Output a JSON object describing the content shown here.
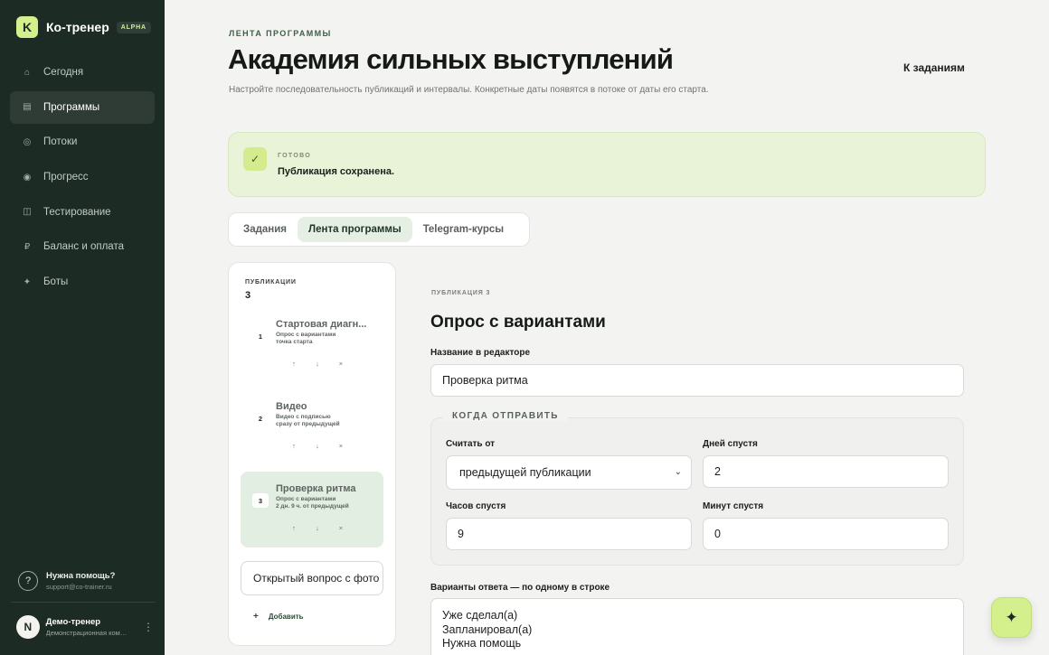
{
  "brand": {
    "logo_letter": "K",
    "name": "Ко-тренер",
    "badge": "ALPHA"
  },
  "nav": [
    {
      "label": "Сегодня",
      "icon": "home-icon",
      "glyph": "⌂"
    },
    {
      "label": "Программы",
      "icon": "list-icon",
      "glyph": "▤"
    },
    {
      "label": "Потоки",
      "icon": "flow-icon",
      "glyph": "◎"
    },
    {
      "label": "Прогресс",
      "icon": "progress-icon",
      "glyph": "◉"
    },
    {
      "label": "Тестирование",
      "icon": "test-icon",
      "glyph": "◫"
    },
    {
      "label": "Баланс и оплата",
      "icon": "ruble-icon",
      "glyph": "₽"
    },
    {
      "label": "Боты",
      "icon": "sparkle-icon",
      "glyph": "✦"
    }
  ],
  "nav_active": "Программы",
  "help": {
    "icon": "?",
    "title": "Нужна помощь?",
    "email": "support@co-trainer.ru"
  },
  "user": {
    "initial": "N",
    "name": "Демо-тренер",
    "org": "Демонстрационная ком…",
    "menu": "⋮"
  },
  "header": {
    "eyebrow": "ЛЕНТА ПРОГРАММЫ",
    "title": "Академия сильных выступлений",
    "description": "Настройте последовательность публикаций и интервалы. Конкретные даты появятся в потоке от даты его старта.",
    "back_link": "К заданиям"
  },
  "alert": {
    "icon": "✓",
    "label": "ГОТОВО",
    "message": "Публикация сохранена."
  },
  "tabs": [
    {
      "label": "Задания"
    },
    {
      "label": "Лента программы"
    },
    {
      "label": "Telegram-курсы"
    }
  ],
  "publications": {
    "label": "ПУБЛИКАЦИИ",
    "count": "3",
    "items": [
      {
        "num": "1",
        "title": "Стартовая диагн...",
        "sub_line1": "Опрос с вариантами",
        "sub_line2": "точка старта",
        "selected": false
      },
      {
        "num": "2",
        "title": "Видео",
        "sub_line1": "Видео с подписью",
        "sub_line2": "сразу от предыдущей",
        "selected": false
      },
      {
        "num": "3",
        "title": "Проверка ритма",
        "sub_line1": "Опрос с вариантами",
        "sub_line2": "2 дн. 9 ч. от предыдущей",
        "selected": true
      }
    ],
    "actions": {
      "up": "↑",
      "down": "↓",
      "delete": "×"
    },
    "type_select": "Открытый вопрос с фото",
    "add_plus": "+",
    "add_label": "Добавить"
  },
  "editor": {
    "eyebrow": "ПУБЛИКАЦИЯ 3",
    "title": "Опрос с вариантами",
    "name_label": "Название в редакторе",
    "name_value": "Проверка ритма",
    "schedule_legend": "КОГДА ОТПРАВИТЬ",
    "count_from_label": "Считать от",
    "count_from_value": "предыдущей публикации",
    "days_label": "Дней спустя",
    "days_value": "2",
    "hours_label": "Часов спустя",
    "hours_value": "9",
    "minutes_label": "Минут спустя",
    "minutes_value": "0",
    "options_label": "Варианты ответа — по одному в строке",
    "options": [
      "Уже сделал(а)",
      "Запланировал(а)",
      "Нужна помощь"
    ]
  },
  "fab": {
    "icon": "sparkle-icon",
    "glyph": "✦"
  },
  "colors": {
    "sidebar": "#1d2b25",
    "accent": "#d4f08c",
    "alert_bg": "#e9f3d8",
    "tab_active": "#e6efe3"
  }
}
